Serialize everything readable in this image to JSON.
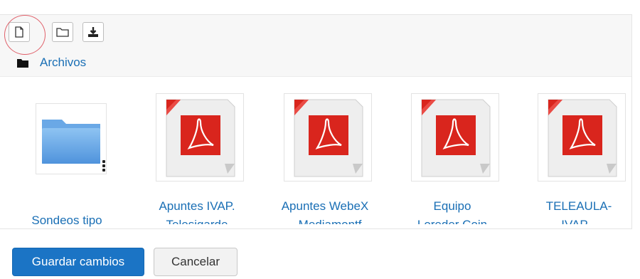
{
  "toolbar": {
    "buttons": [
      {
        "name": "create-file",
        "icon": "file-icon"
      },
      {
        "name": "create-folder",
        "icon": "folder-icon"
      },
      {
        "name": "download",
        "icon": "download-icon"
      }
    ]
  },
  "path": {
    "icon": "folder-icon",
    "label": "Archivos"
  },
  "files": [
    {
      "name": "Sondeos tipo",
      "line2": "",
      "type": "folder"
    },
    {
      "name": "Apuntes IVAP.",
      "line2": "Telesigarde",
      "type": "pdf"
    },
    {
      "name": "Apuntes WebeX",
      "line2": "– Mediamontf",
      "type": "pdf"
    },
    {
      "name": "Equipo",
      "line2": "Loreder Coin",
      "type": "pdf"
    },
    {
      "name": "TELEAULA-",
      "line2": "IVAP...",
      "type": "pdf"
    }
  ],
  "actions": {
    "save_label": "Guardar cambios",
    "cancel_label": "Cancelar"
  },
  "colors": {
    "link": "#1a6fb5",
    "primary": "#1b74c5",
    "pdf_red": "#d9251d",
    "folder_blue": "#5a9de0"
  }
}
